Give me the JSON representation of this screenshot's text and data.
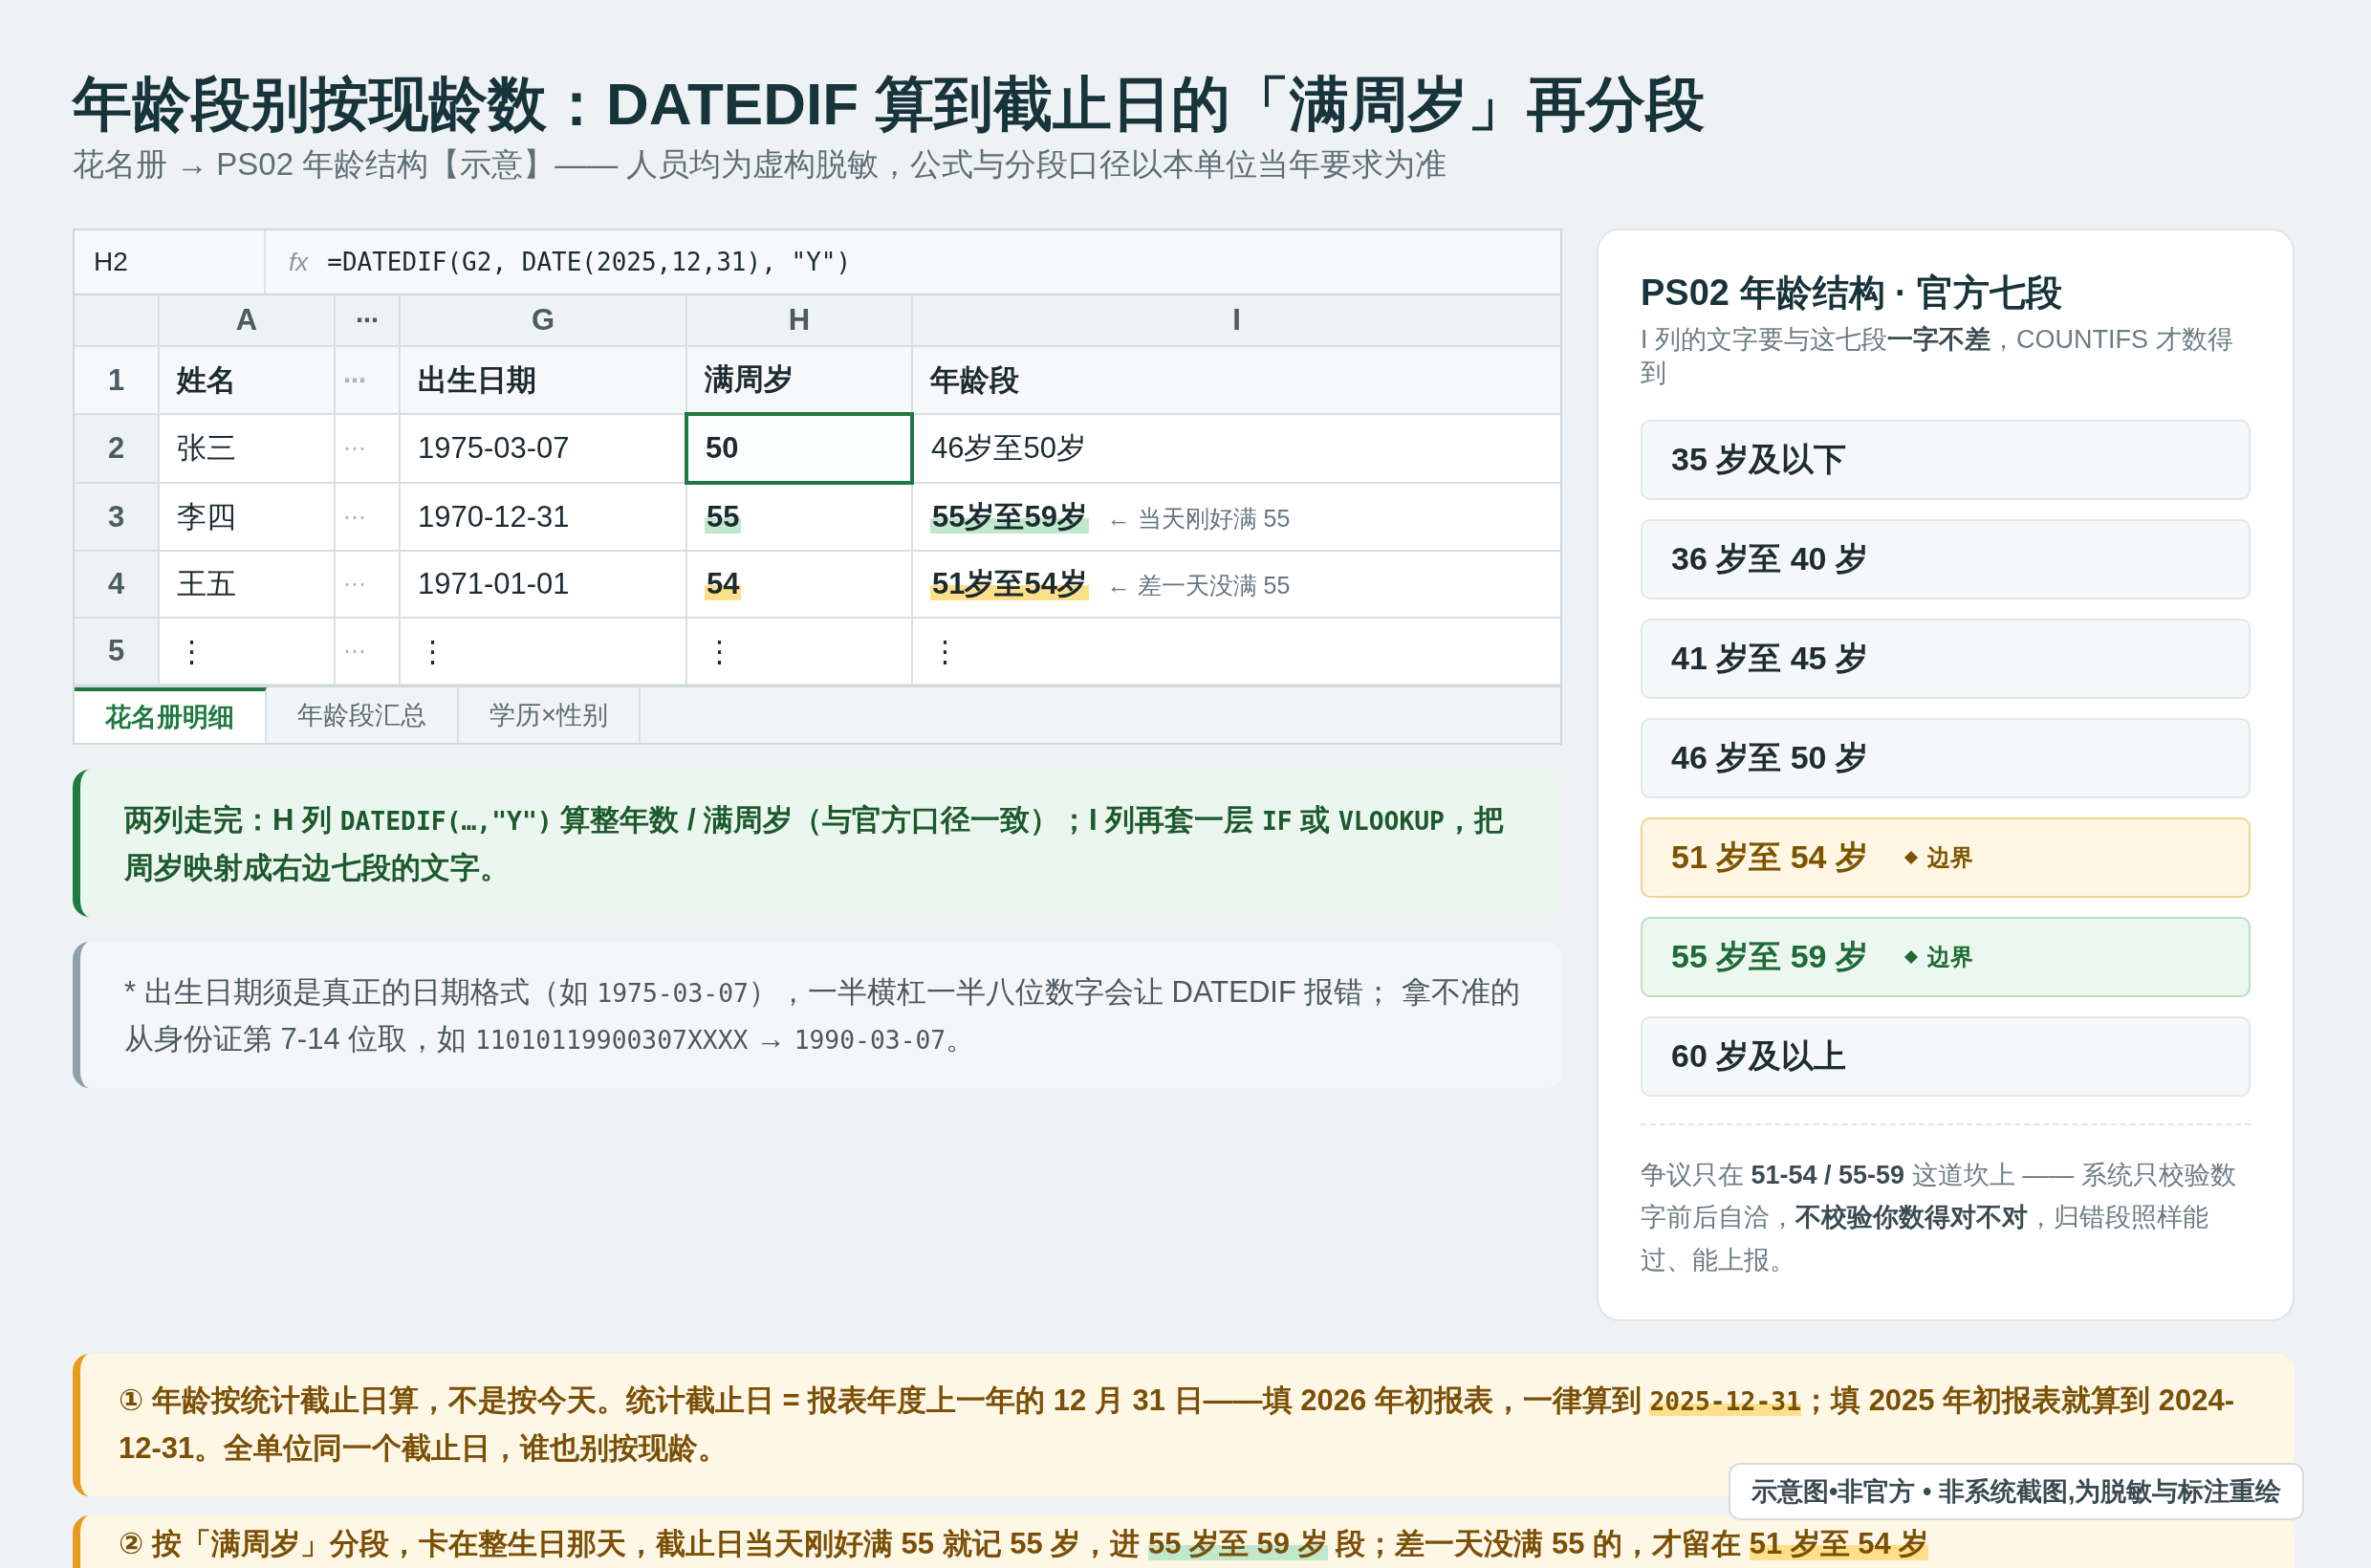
{
  "title": "年龄段别按现龄数：DATEDIF 算到截止日的「满周岁」再分段",
  "subtitle": "花名册 → PS02 年龄结构【示意】—— 人员均为虚构脱敏，公式与分段口径以本单位当年要求为准",
  "sheet": {
    "cell_ref": "H2",
    "fx_label": "fx",
    "formula": "=DATEDIF(G2, DATE(2025,12,31), \"Y\")",
    "columns": [
      "A",
      "⋯",
      "G",
      "H",
      "I"
    ],
    "header": {
      "num": "1",
      "name": "姓名",
      "gap": "⋯",
      "birth": "出生日期",
      "age": "满周岁",
      "band": "年龄段"
    },
    "rows": [
      {
        "num": "2",
        "name": "张三",
        "gap": "⋯",
        "birth": "1975-03-07",
        "age": "50",
        "band": "46岁至50岁",
        "selected": true,
        "kind": "plain"
      },
      {
        "num": "3",
        "name": "李四",
        "gap": "⋯",
        "birth": "1970-12-31",
        "age": "55",
        "band": "55岁至59岁",
        "note": "← 当天刚好满 55",
        "selected": false,
        "kind": "green"
      },
      {
        "num": "4",
        "name": "王五",
        "gap": "⋯",
        "birth": "1971-01-01",
        "age": "54",
        "band": "51岁至54岁",
        "note": "← 差一天没满 55",
        "selected": false,
        "kind": "yellow"
      },
      {
        "num": "5",
        "name": "⋮",
        "gap": "⋯",
        "birth": "⋮",
        "age": "⋮",
        "band": "⋮",
        "selected": false,
        "kind": "plain"
      }
    ],
    "tabs": [
      {
        "label": "花名册明细",
        "selected": true
      },
      {
        "label": "年龄段汇总",
        "selected": false
      },
      {
        "label": "学历×性别",
        "selected": false
      }
    ]
  },
  "notes": [
    {
      "kind": "green",
      "segments": [
        {
          "kind": "text",
          "text": "两列走完：H 列 "
        },
        {
          "kind": "code",
          "text": "DATEDIF(…,\"Y\")"
        },
        {
          "kind": "text",
          "text": " 算整年数 / 满周岁（与官方口径一致）；I 列再套一层 "
        },
        {
          "kind": "code",
          "text": "IF"
        },
        {
          "kind": "text",
          "text": " 或 "
        },
        {
          "kind": "code",
          "text": "VLOOKUP"
        },
        {
          "kind": "text",
          "text": "，把周岁映射成右边七段的文字。"
        }
      ]
    },
    {
      "kind": "grey",
      "segments": [
        {
          "kind": "text",
          "text": "* 出生日期须是真正的日期格式（如 "
        },
        {
          "kind": "code",
          "text": "1975-03-07"
        },
        {
          "kind": "text",
          "text": "），一半横杠一半八位数字会让 DATEDIF 报错； 拿不准的从身份证第 7-14 位取，如 "
        },
        {
          "kind": "code",
          "text": "11010119900307XXXX"
        },
        {
          "kind": "text",
          "text": " → "
        },
        {
          "kind": "code",
          "text": "1990-03-07"
        },
        {
          "kind": "text",
          "text": "。"
        }
      ]
    }
  ],
  "panel": {
    "title": "PS02 年龄结构 · 官方七段",
    "intro": "I 列的文字要与这七段**一字不差**，COUNTIFS 才数得到",
    "bands": [
      {
        "label": "35 岁及以下",
        "kind": "plain"
      },
      {
        "label": "36 岁至 40 岁",
        "kind": "plain"
      },
      {
        "label": "41 岁至 45 岁",
        "kind": "plain"
      },
      {
        "label": "46 岁至 50 岁",
        "kind": "plain"
      },
      {
        "label": "51 岁至 54 岁",
        "kind": "yellow",
        "tag": "边界"
      },
      {
        "label": "55 岁至 59 岁",
        "kind": "green",
        "tag": "边界"
      },
      {
        "label": "60 岁及以上",
        "kind": "plain"
      }
    ],
    "footer": "争议只在 **51-54 / 55-59** 这道坎上 —— 系统只校验数字前后自洽，**不校验你数得对不对**，归错段照样能过、能上报。"
  },
  "callouts": [
    {
      "segments": [
        {
          "kind": "text",
          "text": "① 年龄按统计截止日算，不是按今天。统计截止日 = 报表年度上一年的 12 月 31 日——填 2026 年初报表，一律算到 "
        },
        {
          "kind": "code-yellow",
          "text": "2025-12-31"
        },
        {
          "kind": "text",
          "text": "；填 2025 年初报表就算到 2024-12-31。全单位同一个截止日，谁也别按现龄。"
        }
      ]
    },
    {
      "segments": [
        {
          "kind": "text",
          "text": "② 按「满周岁」分段，卡在整生日那天，截止日当天刚好满 55 就记 55 岁，进 "
        },
        {
          "kind": "green",
          "text": "55 岁至 59 岁"
        },
        {
          "kind": "text",
          "text": " 段；差一天没满 55 的，才留在 "
        },
        {
          "kind": "yellow",
          "text": "51 岁至 54 岁"
        }
      ]
    }
  ],
  "badge": "示意图•非官方 • 非系统截图,为脱敏与标注重绘"
}
